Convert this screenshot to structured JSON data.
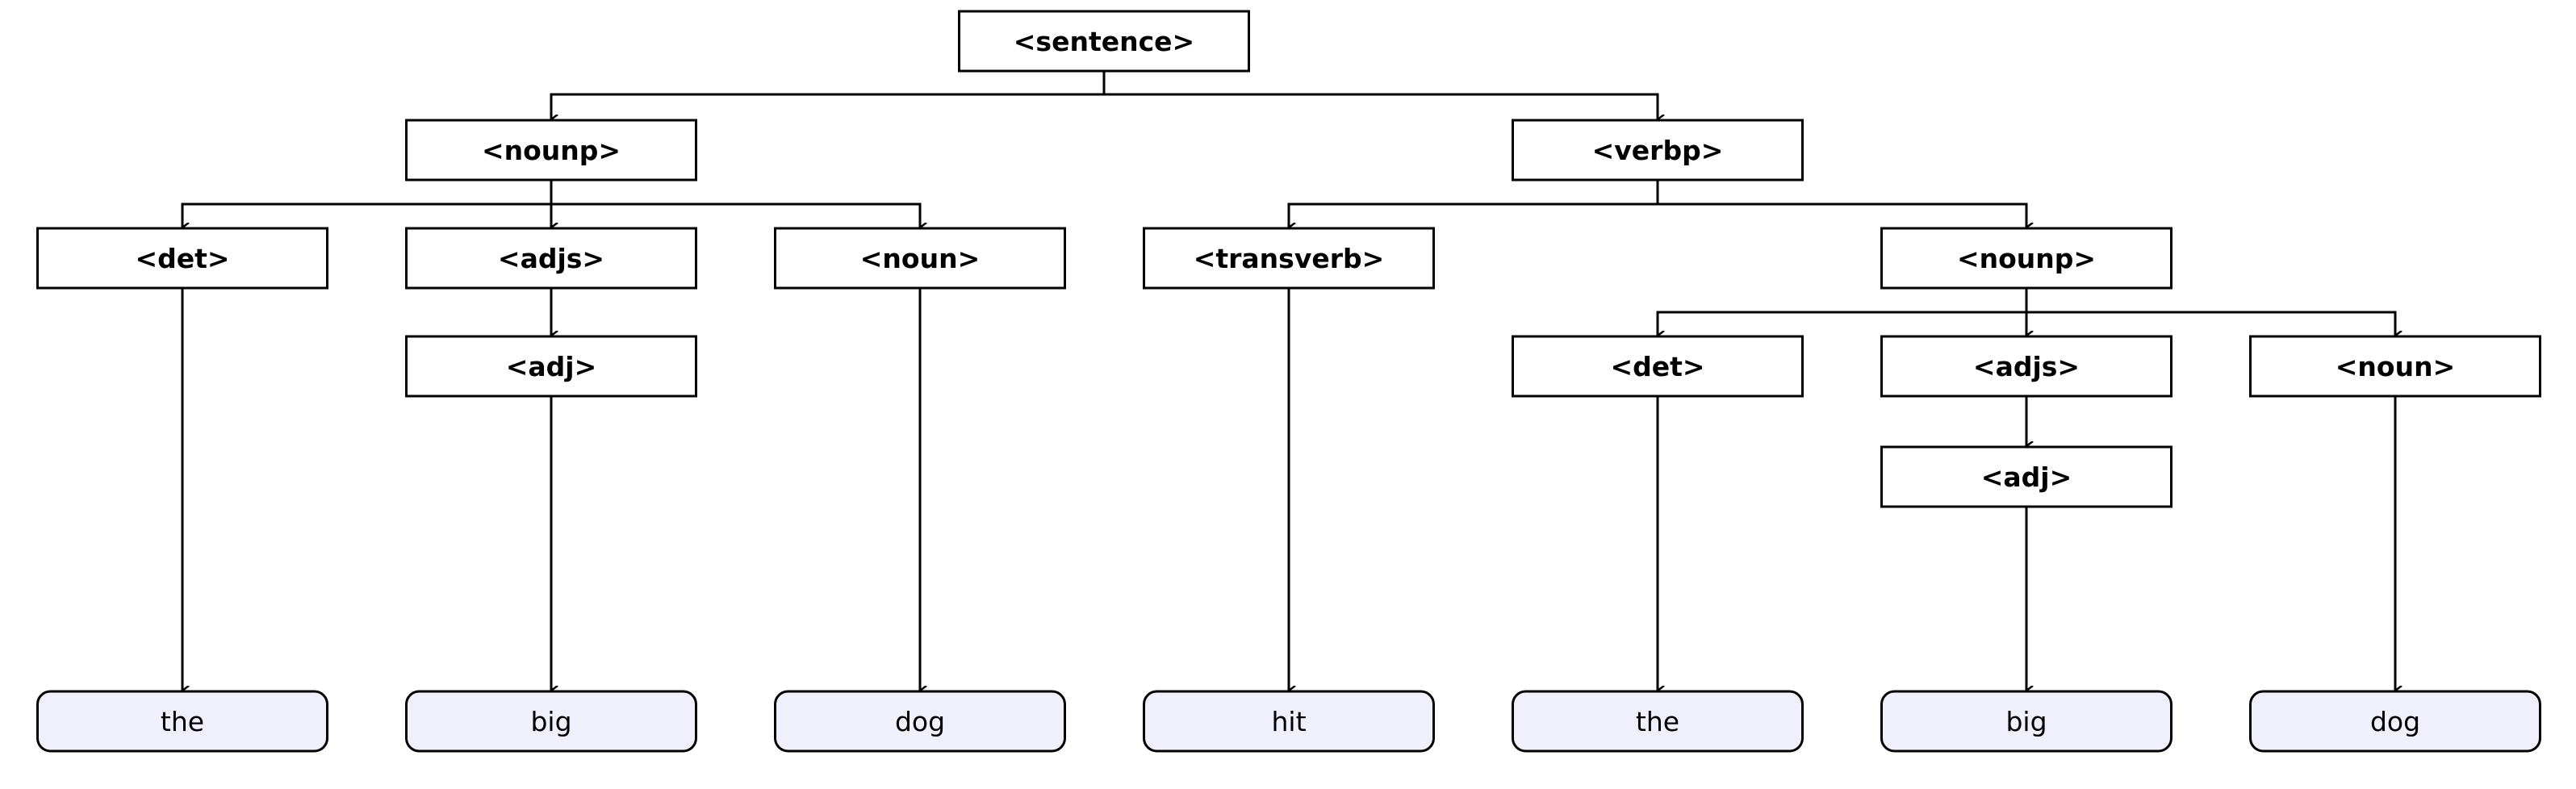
{
  "diagram": {
    "type": "parse-tree",
    "colors": {
      "stroke": "#000000",
      "leaf_fill": "#f0f0fc",
      "node_fill": "#ffffff"
    },
    "nodes": [
      {
        "id": "sentence",
        "label": "<sentence>",
        "kind": "nonterminal",
        "children": [
          "nounp1",
          "verbp"
        ]
      },
      {
        "id": "nounp1",
        "label": "<nounp>",
        "kind": "nonterminal",
        "children": [
          "det1",
          "adjs1",
          "noun1"
        ]
      },
      {
        "id": "verbp",
        "label": "<verbp>",
        "kind": "nonterminal",
        "children": [
          "transverb",
          "nounp2"
        ]
      },
      {
        "id": "det1",
        "label": "<det>",
        "kind": "nonterminal",
        "children": [
          "w_the1"
        ]
      },
      {
        "id": "adjs1",
        "label": "<adjs>",
        "kind": "nonterminal",
        "children": [
          "adj1"
        ]
      },
      {
        "id": "adj1",
        "label": "<adj>",
        "kind": "nonterminal",
        "children": [
          "w_big1"
        ]
      },
      {
        "id": "noun1",
        "label": "<noun>",
        "kind": "nonterminal",
        "children": [
          "w_dog1"
        ]
      },
      {
        "id": "transverb",
        "label": "<transverb>",
        "kind": "nonterminal",
        "children": [
          "w_hit"
        ]
      },
      {
        "id": "nounp2",
        "label": "<nounp>",
        "kind": "nonterminal",
        "children": [
          "det2",
          "adjs2",
          "noun2"
        ]
      },
      {
        "id": "det2",
        "label": "<det>",
        "kind": "nonterminal",
        "children": [
          "w_the2"
        ]
      },
      {
        "id": "adjs2",
        "label": "<adjs>",
        "kind": "nonterminal",
        "children": [
          "adj2"
        ]
      },
      {
        "id": "adj2",
        "label": "<adj>",
        "kind": "nonterminal",
        "children": [
          "w_big2"
        ]
      },
      {
        "id": "noun2",
        "label": "<noun>",
        "kind": "nonterminal",
        "children": [
          "w_dog2"
        ]
      },
      {
        "id": "w_the1",
        "label": "the",
        "kind": "terminal",
        "children": []
      },
      {
        "id": "w_big1",
        "label": "big",
        "kind": "terminal",
        "children": []
      },
      {
        "id": "w_dog1",
        "label": "dog",
        "kind": "terminal",
        "children": []
      },
      {
        "id": "w_hit",
        "label": "hit",
        "kind": "terminal",
        "children": []
      },
      {
        "id": "w_the2",
        "label": "the",
        "kind": "terminal",
        "children": []
      },
      {
        "id": "w_big2",
        "label": "big",
        "kind": "terminal",
        "children": []
      },
      {
        "id": "w_dog2",
        "label": "dog",
        "kind": "terminal",
        "children": []
      }
    ]
  }
}
